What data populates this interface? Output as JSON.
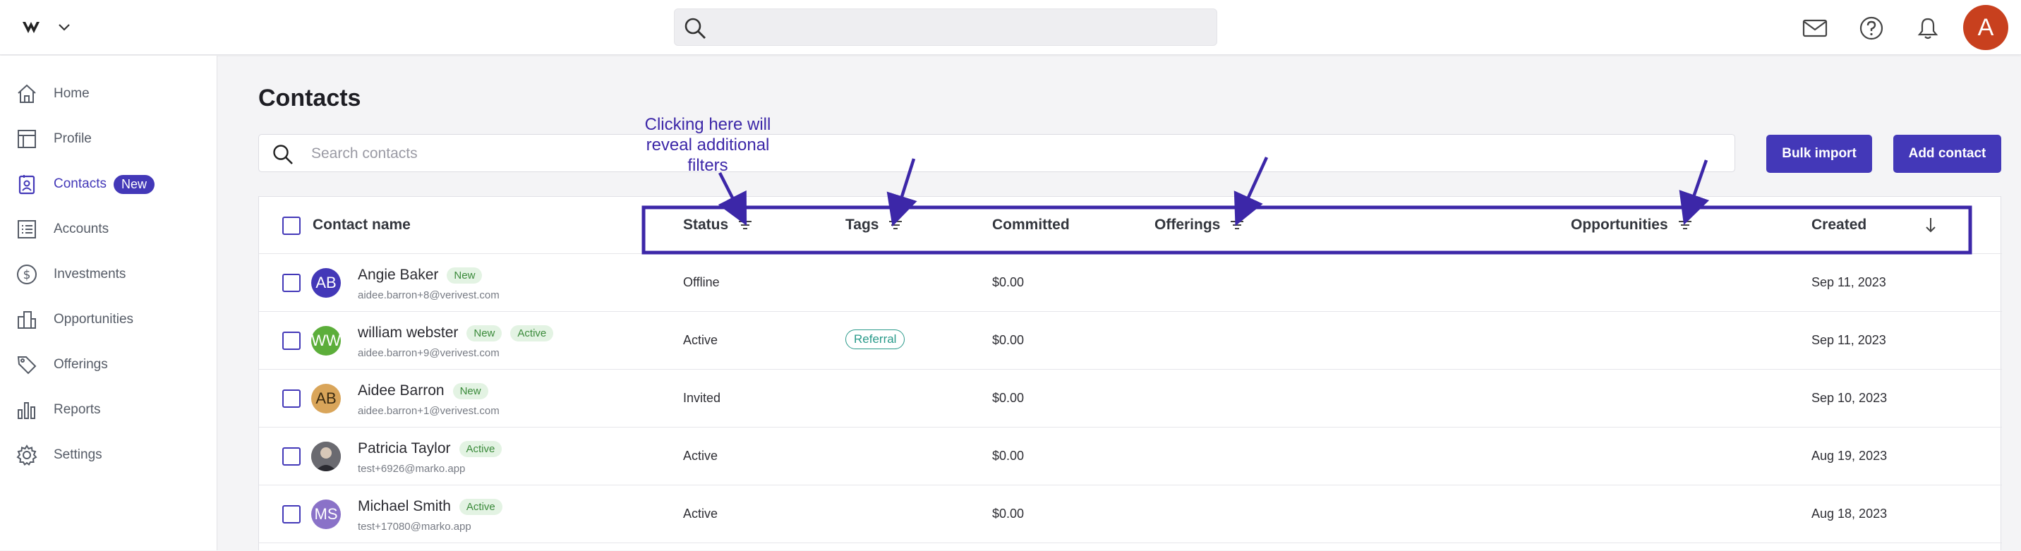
{
  "topbar": {
    "search_value": ""
  },
  "sidebar": {
    "items": [
      {
        "label": "Home",
        "icon": "home-icon"
      },
      {
        "label": "Profile",
        "icon": "profile-icon"
      },
      {
        "label": "Contacts",
        "icon": "contacts-icon",
        "badge": "New",
        "active": true
      },
      {
        "label": "Accounts",
        "icon": "accounts-icon"
      },
      {
        "label": "Investments",
        "icon": "investments-icon"
      },
      {
        "label": "Opportunities",
        "icon": "opportunities-icon"
      },
      {
        "label": "Offerings",
        "icon": "offerings-icon"
      },
      {
        "label": "Reports",
        "icon": "reports-icon"
      },
      {
        "label": "Settings",
        "icon": "settings-icon"
      }
    ]
  },
  "user": {
    "initial": "A"
  },
  "main": {
    "title": "Contacts",
    "search_placeholder": "Search contacts",
    "bulk_import_label": "Bulk import",
    "add_contact_label": "Add contact"
  },
  "annotation": {
    "lines": [
      "Clicking here will",
      "reveal additional",
      "filters"
    ]
  },
  "table": {
    "columns": {
      "name": "Contact name",
      "status": "Status",
      "tags": "Tags",
      "committed": "Committed",
      "offerings": "Offerings",
      "opportunities": "Opportunities",
      "created": "Created"
    },
    "rows": [
      {
        "initials": "AB",
        "avatar_color": "#4338b8",
        "name": "Angie Baker",
        "email": "aidee.barron+8@verivest.com",
        "badges": [
          "New"
        ],
        "status": "Offline",
        "tag": "",
        "committed": "$0.00",
        "created": "Sep 11, 2023"
      },
      {
        "initials": "WW",
        "avatar_color": "#5cae3a",
        "name": "william webster",
        "email": "aidee.barron+9@verivest.com",
        "badges": [
          "New",
          "Active"
        ],
        "status": "Active",
        "tag": "Referral",
        "committed": "$0.00",
        "created": "Sep 11, 2023"
      },
      {
        "initials": "AB",
        "avatar_color": "#d9a55a",
        "name": "Aidee Barron",
        "email": "aidee.barron+1@verivest.com",
        "badges": [
          "New"
        ],
        "status": "Invited",
        "tag": "",
        "committed": "$0.00",
        "created": "Sep 10, 2023"
      },
      {
        "initials": "",
        "avatar_color": "#4a4a50",
        "name": "Patricia Taylor",
        "email": "test+6926@marko.app",
        "badges": [
          "Active"
        ],
        "status": "Active",
        "tag": "",
        "committed": "$0.00",
        "created": "Aug 19, 2023"
      },
      {
        "initials": "MS",
        "avatar_color": "#8a72c8",
        "name": "Michael Smith",
        "email": "test+17080@marko.app",
        "badges": [
          "Active"
        ],
        "status": "Active",
        "tag": "",
        "committed": "$0.00",
        "created": "Aug 18, 2023"
      }
    ]
  },
  "colors": {
    "accent": "#4338b8",
    "annotation": "#3c27a8",
    "avatar_top": "#c8401e"
  }
}
